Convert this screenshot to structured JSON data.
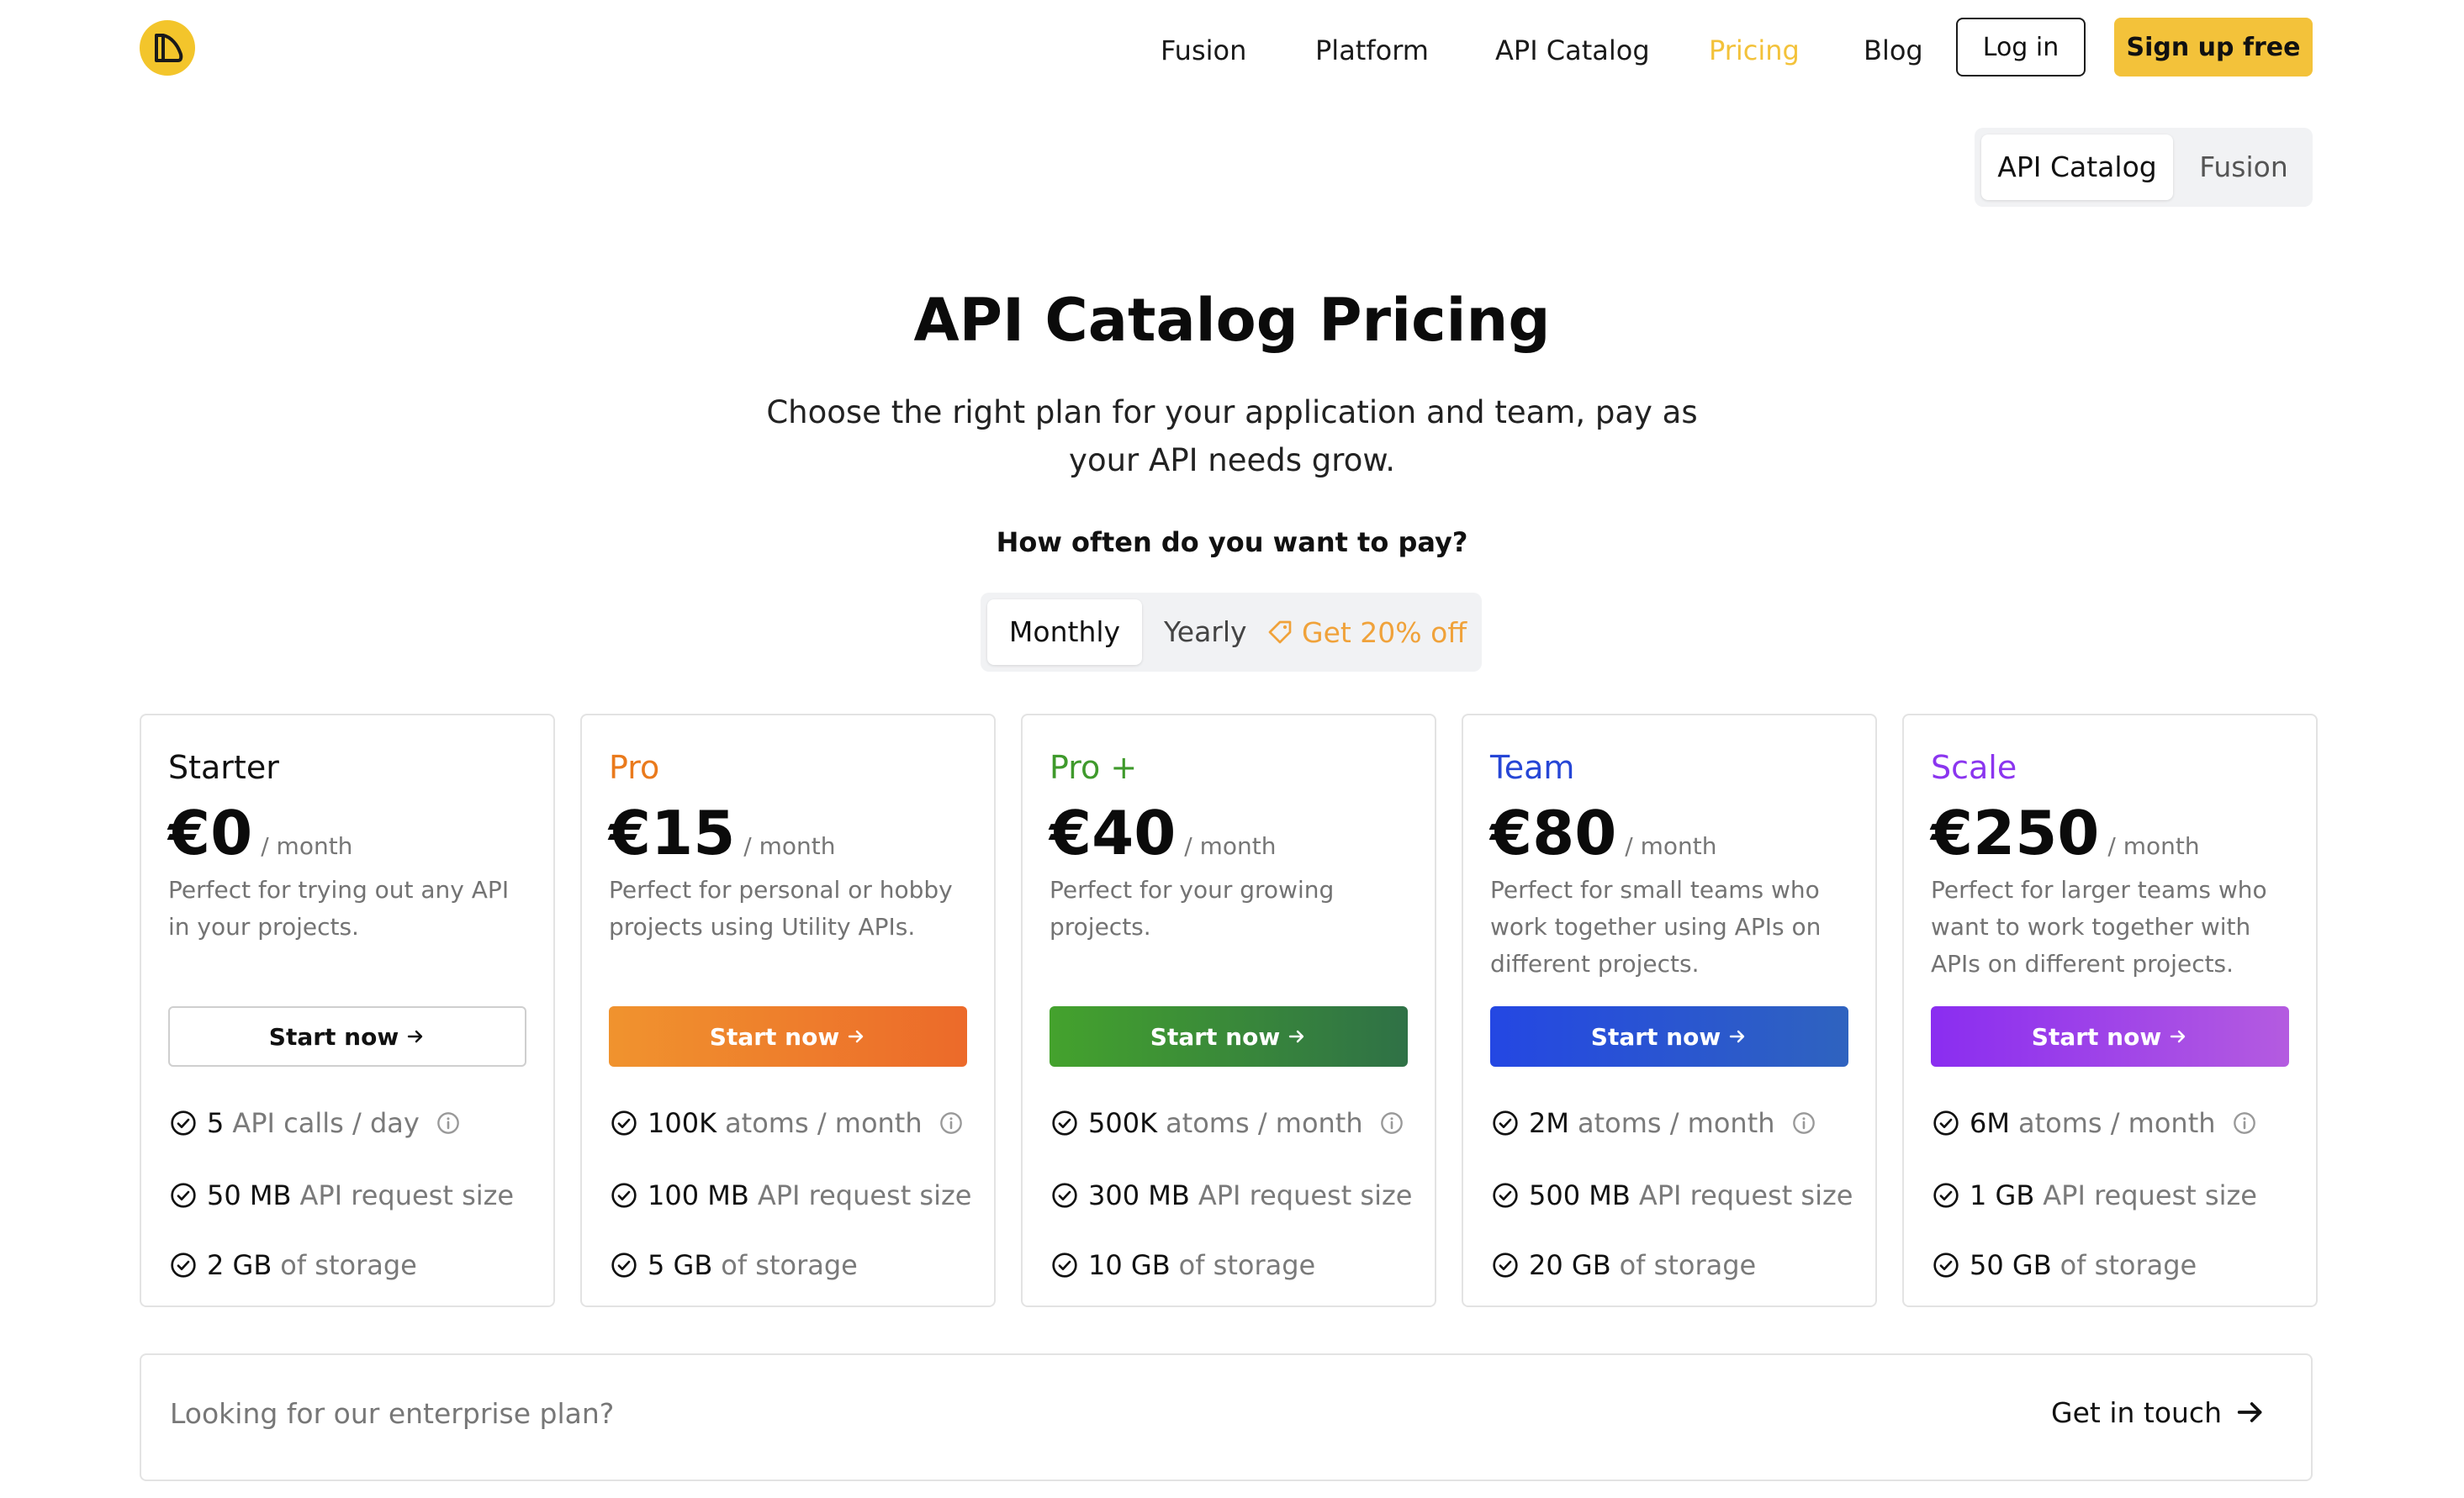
{
  "nav": {
    "links": [
      "Fusion",
      "Platform",
      "API Catalog",
      "Pricing",
      "Blog"
    ],
    "active": "Pricing",
    "login": "Log in",
    "signup": "Sign up free"
  },
  "product_switch": {
    "options": [
      "API Catalog",
      "Fusion"
    ],
    "selected": "API Catalog"
  },
  "hero": {
    "title": "API Catalog Pricing",
    "subtitle": "Choose the right plan for your application and team, pay as your API needs grow.",
    "question": "How often do you want to pay?"
  },
  "billing": {
    "monthly": "Monthly",
    "yearly": "Yearly",
    "promo": "Get 20% off",
    "selected": "Monthly"
  },
  "plans": [
    {
      "name": "Starter",
      "price": "€0",
      "period": "/ month",
      "desc": "Perfect for trying out any API in your projects.",
      "cta": "Start now",
      "features": [
        {
          "value": "5",
          "unit": "API calls / day"
        },
        {
          "value": "50 MB",
          "unit": "API request size"
        },
        {
          "value": "2 GB",
          "unit": "of storage"
        }
      ]
    },
    {
      "name": "Pro",
      "price": "€15",
      "period": "/ month",
      "desc": "Perfect for personal or hobby projects using Utility APIs.",
      "cta": "Start now",
      "features": [
        {
          "value": "100K",
          "unit": "atoms / month"
        },
        {
          "value": "100 MB",
          "unit": "API request size"
        },
        {
          "value": "5 GB",
          "unit": "of storage"
        }
      ]
    },
    {
      "name": "Pro +",
      "price": "€40",
      "period": "/ month",
      "desc": "Perfect for your growing projects.",
      "cta": "Start now",
      "features": [
        {
          "value": "500K",
          "unit": "atoms / month"
        },
        {
          "value": "300 MB",
          "unit": "API request size"
        },
        {
          "value": "10 GB",
          "unit": "of storage"
        }
      ]
    },
    {
      "name": "Team",
      "price": "€80",
      "period": "/ month",
      "desc": "Perfect for small teams who work together using APIs on different projects.",
      "cta": "Start now",
      "features": [
        {
          "value": "2M",
          "unit": "atoms / month"
        },
        {
          "value": "500 MB",
          "unit": "API request size"
        },
        {
          "value": "20 GB",
          "unit": "of storage"
        }
      ]
    },
    {
      "name": "Scale",
      "price": "€250",
      "period": "/ month",
      "desc": "Perfect for larger teams who want to work together with APIs on different projects.",
      "cta": "Start now",
      "features": [
        {
          "value": "6M",
          "unit": "atoms / month"
        },
        {
          "value": "1 GB",
          "unit": "API request size"
        },
        {
          "value": "50 GB",
          "unit": "of storage"
        }
      ]
    }
  ],
  "enterprise": {
    "question": "Looking for our enterprise plan?",
    "link": "Get in touch"
  },
  "colors": {
    "brand_yellow": "#f3c23a",
    "promo_orange": "#f0a23a",
    "pro": "#ea7a1c",
    "pro_plus": "#3f9a2c",
    "team": "#2646d6",
    "scale": "#8b35ef"
  }
}
